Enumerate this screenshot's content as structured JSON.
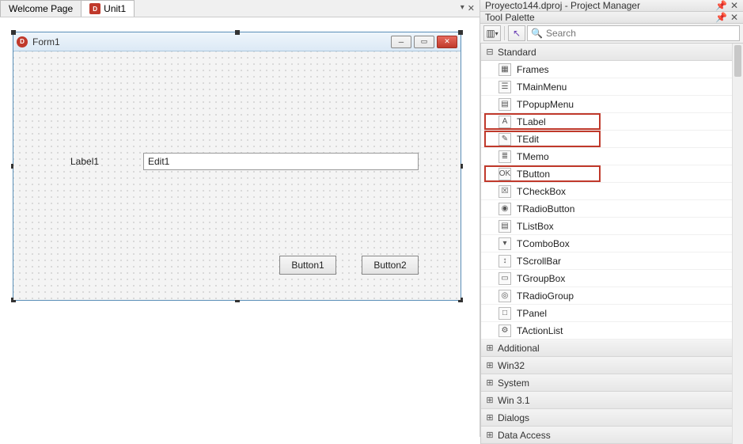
{
  "tabs": {
    "welcome": "Welcome Page",
    "unit": "Unit1"
  },
  "form": {
    "title": "Form1",
    "label": "Label1",
    "edit": "Edit1",
    "button1": "Button1",
    "button2": "Button2"
  },
  "projectManager": {
    "title": "Proyecto144.dproj - Project Manager"
  },
  "toolPalette": {
    "title": "Tool Palette",
    "searchPlaceholder": "Search",
    "categories": {
      "standard": "Standard",
      "additional": "Additional",
      "win32": "Win32",
      "system": "System",
      "win31": "Win 3.1",
      "dialogs": "Dialogs",
      "dataAccess": "Data Access"
    },
    "items": {
      "frames": "Frames",
      "mainmenu": "TMainMenu",
      "popupmenu": "TPopupMenu",
      "label": "TLabel",
      "edit": "TEdit",
      "memo": "TMemo",
      "button": "TButton",
      "checkbox": "TCheckBox",
      "radiobutton": "TRadioButton",
      "listbox": "TListBox",
      "combobox": "TComboBox",
      "scrollbar": "TScrollBar",
      "groupbox": "TGroupBox",
      "radiogroup": "TRadioGroup",
      "panel": "TPanel",
      "actionlist": "TActionList"
    }
  }
}
